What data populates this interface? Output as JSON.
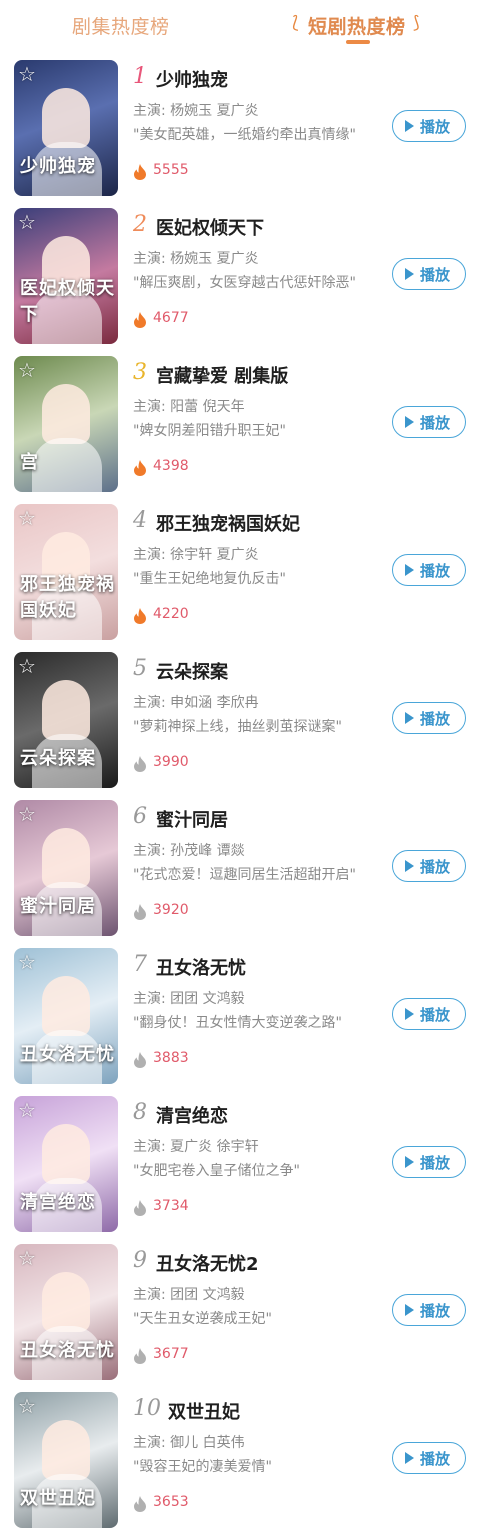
{
  "tabs": {
    "drama_series": "剧集热度榜",
    "short_drama": "短剧热度榜",
    "active": "short_drama"
  },
  "colors": {
    "accent_orange": "#e08a4f",
    "play_blue": "#3a95cc",
    "heat_red": "#e05a6a",
    "flame_hot": "#f07a2a",
    "flame_cool": "#b0b0b0"
  },
  "play_label": "播放",
  "items": [
    {
      "rank": "1",
      "title": "少帅独宠",
      "cast": "主演: 杨婉玉 夏广炎",
      "quote": "\"美女配英雄，一纸婚约牵出真情缘\"",
      "heat": "5555",
      "poster_text": "少帅独宠",
      "hot": true
    },
    {
      "rank": "2",
      "title": "医妃权倾天下",
      "cast": "主演: 杨婉玉 夏广炎",
      "quote": "\"解压爽剧，女医穿越古代惩奸除恶\"",
      "heat": "4677",
      "poster_text": "医妃权倾天下",
      "hot": true
    },
    {
      "rank": "3",
      "title": "宫藏挚爱 剧集版",
      "cast": "主演: 阳蕾 倪天年",
      "quote": "\"婢女阴差阳错升职王妃\"",
      "heat": "4398",
      "poster_text": "宫",
      "hot": true
    },
    {
      "rank": "4",
      "title": "邪王独宠祸国妖妃",
      "cast": "主演: 徐宇轩 夏广炎",
      "quote": "\"重生王妃绝地复仇反击\"",
      "heat": "4220",
      "poster_text": "邪王独宠祸国妖妃",
      "hot": true
    },
    {
      "rank": "5",
      "title": "云朵探案",
      "cast": "主演: 申如涵 李欣冉",
      "quote": "\"萝莉神探上线，抽丝剥茧探谜案\"",
      "heat": "3990",
      "poster_text": "云朵探案",
      "hot": false
    },
    {
      "rank": "6",
      "title": "蜜汁同居",
      "cast": "主演: 孙茂峰 谭燚",
      "quote": "\"花式恋爱！逗趣同居生活超甜开启\"",
      "heat": "3920",
      "poster_text": "蜜汁同居",
      "hot": false
    },
    {
      "rank": "7",
      "title": "丑女洛无忧",
      "cast": "主演: 团团 文鸿毅",
      "quote": "\"翻身仗！丑女性情大变逆袭之路\"",
      "heat": "3883",
      "poster_text": "丑女洛无忧",
      "hot": false
    },
    {
      "rank": "8",
      "title": "清宫绝恋",
      "cast": "主演: 夏广炎 徐宇轩",
      "quote": "\"女肥宅卷入皇子储位之争\"",
      "heat": "3734",
      "poster_text": "清宫绝恋",
      "hot": false
    },
    {
      "rank": "9",
      "title": "丑女洛无忧2",
      "cast": "主演: 团团 文鸿毅",
      "quote": "\"天生丑女逆袭成王妃\"",
      "heat": "3677",
      "poster_text": "丑女洛无忧",
      "hot": false
    },
    {
      "rank": "10",
      "title": "双世丑妃",
      "cast": "主演: 御儿 白英伟",
      "quote": "\"毁容王妃的凄美爱情\"",
      "heat": "3653",
      "poster_text": "双世丑妃",
      "hot": false
    }
  ]
}
